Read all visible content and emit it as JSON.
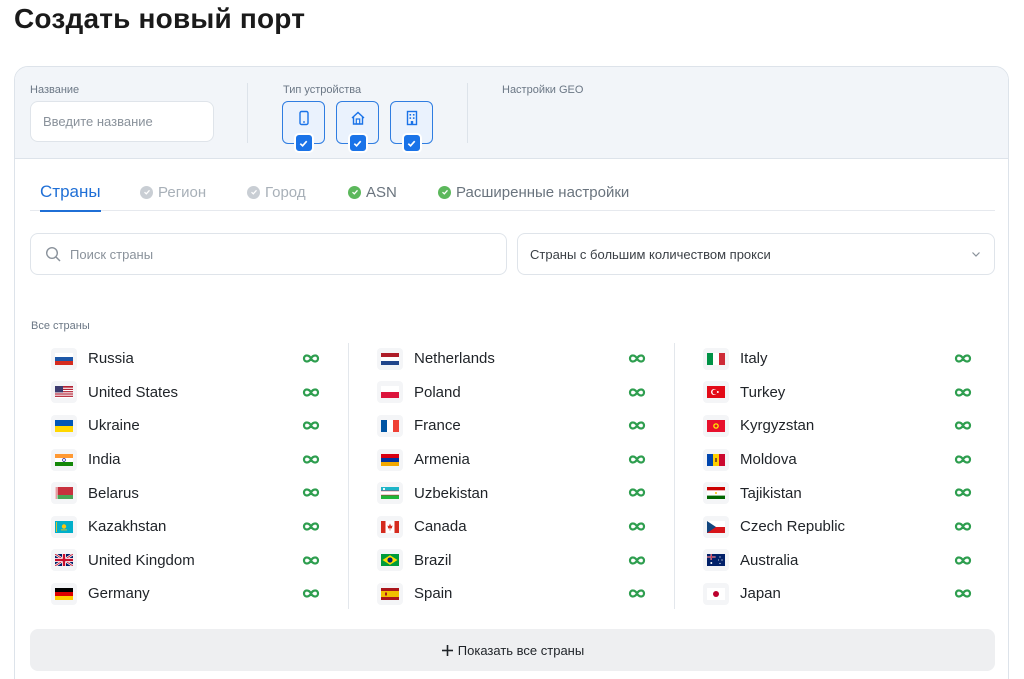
{
  "page": {
    "title": "Создать новый порт"
  },
  "header": {
    "name_label": "Название",
    "name_placeholder": "Введите название",
    "device_label": "Тип устройства",
    "geo_label": "Настройки GEO",
    "devices": [
      {
        "icon": "mobile-icon",
        "checked": true
      },
      {
        "icon": "home-icon",
        "checked": true
      },
      {
        "icon": "building-icon",
        "checked": true
      }
    ]
  },
  "tabs": [
    {
      "label": "Страны",
      "state": "active"
    },
    {
      "label": "Регион",
      "state": "disabled"
    },
    {
      "label": "Город",
      "state": "disabled"
    },
    {
      "label": "ASN",
      "state": "done"
    },
    {
      "label": "Расширенные настройки",
      "state": "done"
    }
  ],
  "search": {
    "placeholder": "Поиск страны"
  },
  "filter": {
    "selected": "Страны с большим количеством прокси"
  },
  "section_label": "Все страны",
  "countries": [
    {
      "name": "Russia",
      "flag": "ru"
    },
    {
      "name": "United States",
      "flag": "us"
    },
    {
      "name": "Ukraine",
      "flag": "ua"
    },
    {
      "name": "India",
      "flag": "in"
    },
    {
      "name": "Belarus",
      "flag": "by"
    },
    {
      "name": "Kazakhstan",
      "flag": "kz"
    },
    {
      "name": "United Kingdom",
      "flag": "gb"
    },
    {
      "name": "Germany",
      "flag": "de"
    },
    {
      "name": "Netherlands",
      "flag": "nl"
    },
    {
      "name": "Poland",
      "flag": "pl"
    },
    {
      "name": "France",
      "flag": "fr"
    },
    {
      "name": "Armenia",
      "flag": "am"
    },
    {
      "name": "Uzbekistan",
      "flag": "uz"
    },
    {
      "name": "Canada",
      "flag": "ca"
    },
    {
      "name": "Brazil",
      "flag": "br"
    },
    {
      "name": "Spain",
      "flag": "es"
    },
    {
      "name": "Italy",
      "flag": "it"
    },
    {
      "name": "Turkey",
      "flag": "tr"
    },
    {
      "name": "Kyrgyzstan",
      "flag": "kg"
    },
    {
      "name": "Moldova",
      "flag": "md"
    },
    {
      "name": "Tajikistan",
      "flag": "tj"
    },
    {
      "name": "Czech Republic",
      "flag": "cz"
    },
    {
      "name": "Australia",
      "flag": "au"
    },
    {
      "name": "Japan",
      "flag": "jp"
    }
  ],
  "show_all": {
    "label": "Показать все страны"
  },
  "colors": {
    "accent": "#1f6fd6",
    "check_blue": "#1a73e8",
    "done_green": "#5cb85c",
    "infinity_green": "#2e9e4f"
  }
}
